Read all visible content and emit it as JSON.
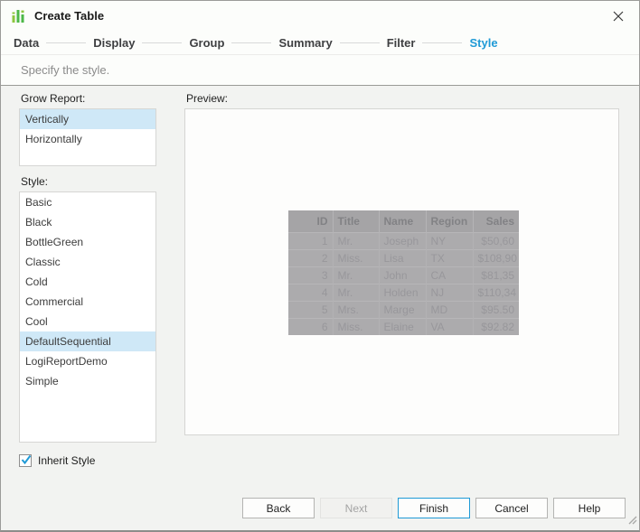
{
  "window": {
    "title": "Create Table"
  },
  "wizard": {
    "steps": [
      {
        "label": "Data",
        "active": false
      },
      {
        "label": "Display",
        "active": false
      },
      {
        "label": "Group",
        "active": false
      },
      {
        "label": "Summary",
        "active": false
      },
      {
        "label": "Filter",
        "active": false
      },
      {
        "label": "Style",
        "active": true
      }
    ]
  },
  "subtitle": "Specify the style.",
  "panel": {
    "grow_report": {
      "label": "Grow Report:",
      "options": [
        {
          "label": "Vertically",
          "selected": true
        },
        {
          "label": "Horizontally",
          "selected": false
        }
      ]
    },
    "style": {
      "label": "Style:",
      "options": [
        {
          "label": "Basic",
          "selected": false
        },
        {
          "label": "Black",
          "selected": false
        },
        {
          "label": "BottleGreen",
          "selected": false
        },
        {
          "label": "Classic",
          "selected": false
        },
        {
          "label": "Cold",
          "selected": false
        },
        {
          "label": "Commercial",
          "selected": false
        },
        {
          "label": "Cool",
          "selected": false
        },
        {
          "label": "DefaultSequential",
          "selected": true
        },
        {
          "label": "LogiReportDemo",
          "selected": false
        },
        {
          "label": "Simple",
          "selected": false
        }
      ]
    },
    "inherit_style": {
      "label": "Inherit Style",
      "checked": true
    }
  },
  "preview": {
    "label": "Preview:",
    "table": {
      "columns": [
        {
          "label": "ID",
          "align": "right",
          "width": 49
        },
        {
          "label": "Title",
          "align": "left",
          "width": 51
        },
        {
          "label": "Name",
          "align": "left",
          "width": 52
        },
        {
          "label": "Region",
          "align": "left",
          "width": 52
        },
        {
          "label": "Sales",
          "align": "right",
          "width": 51
        }
      ],
      "rows": [
        [
          "1",
          "Mr.",
          "Joseph",
          "NY",
          "$50,60"
        ],
        [
          "2",
          "Miss.",
          "Lisa",
          "TX",
          "$108,90"
        ],
        [
          "3",
          "Mr.",
          "John",
          "CA",
          "$81,35"
        ],
        [
          "4",
          "Mr.",
          "Holden",
          "NJ",
          "$110,34"
        ],
        [
          "5",
          "Mrs.",
          "Marge",
          "MD",
          "$95.50"
        ],
        [
          "6",
          "Miss.",
          "Elaine",
          "VA",
          "$92.82"
        ]
      ]
    }
  },
  "buttons": [
    {
      "label": "Back",
      "state": "normal"
    },
    {
      "label": "Next",
      "state": "disabled"
    },
    {
      "label": "Finish",
      "state": "default"
    },
    {
      "label": "Cancel",
      "state": "normal"
    },
    {
      "label": "Help",
      "state": "normal"
    }
  ],
  "colors": {
    "accent_blue": "#1f9ad6",
    "selection_blue": "#cfe8f7",
    "body_bg": "#f2f3f1",
    "icon_green_light": "#8dc63f",
    "icon_green": "#4db848",
    "table_header_bg": "#a5a4a6",
    "table_row_bg": "#acabad"
  }
}
